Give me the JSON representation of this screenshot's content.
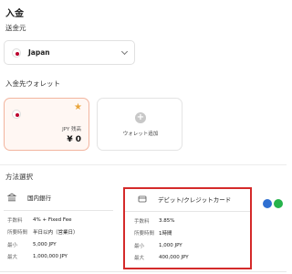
{
  "page": {
    "title": "入金"
  },
  "source": {
    "label": "送金元",
    "country": "Japan"
  },
  "wallet": {
    "label": "入金先ウォレット",
    "currency": "JPY 残高",
    "balance": "¥ 0",
    "add_label": "ウォレット追加"
  },
  "methods": {
    "label": "方法選択",
    "bank": {
      "name": "国内銀行",
      "rows": [
        {
          "k": "手数料",
          "v": "4% + Fixed Fee"
        },
        {
          "k": "所要時間",
          "v": "半日以内（営業日）"
        },
        {
          "k": "最小",
          "v": "5,000 JPY"
        },
        {
          "k": "最大",
          "v": "1,000,000 JPY"
        }
      ]
    },
    "card": {
      "name": "デビット/クレジットカード",
      "rows": [
        {
          "k": "手数料",
          "v": "3.85%"
        },
        {
          "k": "所要時間",
          "v": "1時間"
        },
        {
          "k": "最小",
          "v": "1,000 JPY"
        },
        {
          "k": "最大",
          "v": "400,000 JPY"
        }
      ]
    }
  },
  "colors": {
    "selected_border": "#d42a2a",
    "wallet_border": "#f2b59f",
    "flag_red": "#bc002d"
  }
}
